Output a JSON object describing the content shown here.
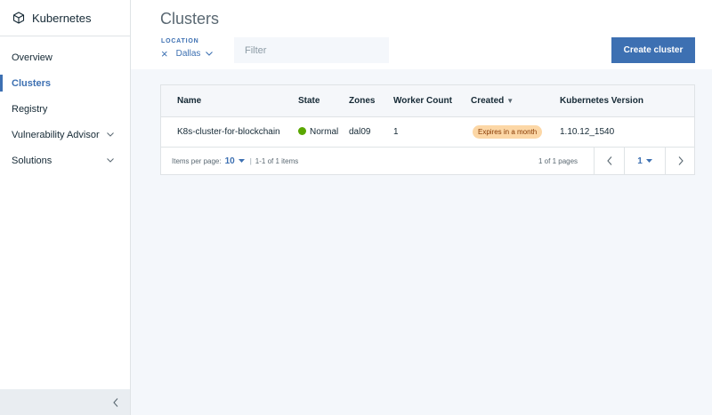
{
  "sidebar": {
    "title": "Kubernetes",
    "items": [
      {
        "label": "Overview"
      },
      {
        "label": "Clusters"
      },
      {
        "label": "Registry"
      },
      {
        "label": "Vulnerability Advisor"
      },
      {
        "label": "Solutions"
      }
    ]
  },
  "header": {
    "title": "Clusters",
    "location_label": "LOCATION",
    "location_value": "Dallas",
    "filter_placeholder": "Filter",
    "create_label": "Create cluster"
  },
  "table": {
    "columns": [
      "Name",
      "State",
      "Zones",
      "Worker Count",
      "Created",
      "Kubernetes Version"
    ],
    "rows": [
      {
        "name": "K8s-cluster-for-blockchain",
        "state": "Normal",
        "zones": "dal09",
        "workers": "1",
        "created": "Expires in a month",
        "version": "1.10.12_1540"
      }
    ]
  },
  "pagination": {
    "items_per_page_label": "Items per page:",
    "items_per_page": "10",
    "range": "1-1 of 1 items",
    "pages": "1 of 1 pages",
    "current_page": "1"
  },
  "colors": {
    "accent": "#3d70b2",
    "state_normal": "#5aa700",
    "badge_bg": "#fcd7a6"
  }
}
